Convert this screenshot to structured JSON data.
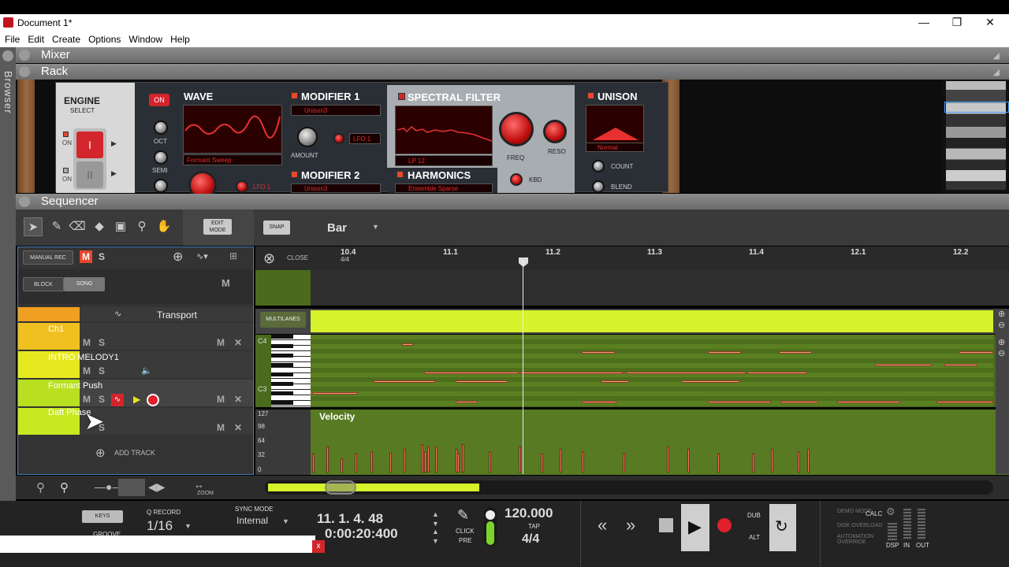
{
  "window": {
    "title": "Document 1*"
  },
  "menu": [
    "File",
    "Edit",
    "Create",
    "Options",
    "Window",
    "Help"
  ],
  "side": {
    "browser_label": "Browser"
  },
  "panels": {
    "mixer": "Mixer",
    "rack": "Rack",
    "sequencer": "Sequencer"
  },
  "device": {
    "engine_title": "ENGINE",
    "engine_sub": "SELECT",
    "on_small_1": "ON",
    "on_small_2": "ON",
    "power": "ON",
    "oct": "OCT",
    "semi": "SEMI",
    "wave": "WAVE",
    "wave_preset": "Formant Sweep",
    "lfo_a": "LFO 1",
    "modifier1": "MODIFIER 1",
    "modifier1_preset": "Unison3",
    "amount": "AMOUNT",
    "lfo_b": "LFO 1",
    "modifier2": "MODIFIER 2",
    "modifier2_preset": "Unison3",
    "spectral": "SPECTRAL FILTER",
    "lp": "LP 12",
    "freq": "FREQ",
    "reso": "RESO",
    "kbd": "KBD",
    "harmonics": "HARMONICS",
    "harmonics_preset": "Ensemble Sparse",
    "unison": "UNISON",
    "unison_mode": "Normal",
    "count": "COUNT",
    "blend": "BLEND"
  },
  "toolbar": {
    "edit_mode": "EDIT\nMODE",
    "snap": "SNAP",
    "snap_value": "Bar"
  },
  "trackpanel": {
    "manual_rec": "MANUAL REC",
    "m": "M",
    "s": "S",
    "block": "BLOCK",
    "song": "SONG",
    "m2": "M",
    "transport": "Transport",
    "tracks": [
      {
        "name": "Ch1",
        "m": "M",
        "s": "S",
        "mm": "M",
        "x": "✕"
      },
      {
        "name": "INTRO MELODY1",
        "m": "M",
        "s": "S"
      },
      {
        "name": "Formant Push",
        "m": "M",
        "s": "S",
        "mm": "M",
        "x": "✕"
      },
      {
        "name": "Daft Phase",
        "s": "S",
        "mm": "M",
        "x": "✕"
      }
    ],
    "add_track": "ADD TRACK"
  },
  "ruler": {
    "close": "CLOSE",
    "marks": [
      "10.4",
      "11.1",
      "11.2",
      "11.3",
      "11.4",
      "12.1",
      "12.2"
    ],
    "sig": "4/4"
  },
  "lanes": {
    "multilanes": "MULTILANES",
    "c4": "C4",
    "c3": "C3",
    "velocity": "Velocity",
    "vel_ticks": [
      "127",
      "98",
      "64",
      "32",
      "0"
    ],
    "velocities": [
      40,
      55,
      30,
      40,
      45,
      42,
      50,
      60,
      45,
      55,
      55,
      50,
      40,
      60,
      45,
      55,
      40,
      50,
      45,
      42,
      55,
      50,
      40,
      40,
      50,
      45,
      50
    ]
  },
  "bottomnav": {
    "zoom": "ZOOM"
  },
  "transport": {
    "keys": "KEYS",
    "groove": "GROOVE",
    "q_record": "Q RECORD",
    "q_value": "1/16",
    "sync_mode": "SYNC MODE",
    "sync_value": "Internal",
    "position": "11.  1.  4.  48",
    "time": "0:00:20:400",
    "click": "CLICK",
    "pre": "PRE",
    "tempo": "120.000",
    "tap": "TAP",
    "signature": "4/4",
    "dub": "DUB",
    "alt": "ALT",
    "demo_mode": "DEMO MODE",
    "disk_overload": "DISK OVERLOAD",
    "automation_override": "AUTOMATION OVERRIDE",
    "calc": "CALC",
    "dsp": "DSP",
    "in": "IN",
    "out": "OUT"
  },
  "notification": {
    "close": "x"
  },
  "colors": {
    "lime": "#d6f22a",
    "red": "#d3252c",
    "accent_blue": "#3f7fbf"
  }
}
